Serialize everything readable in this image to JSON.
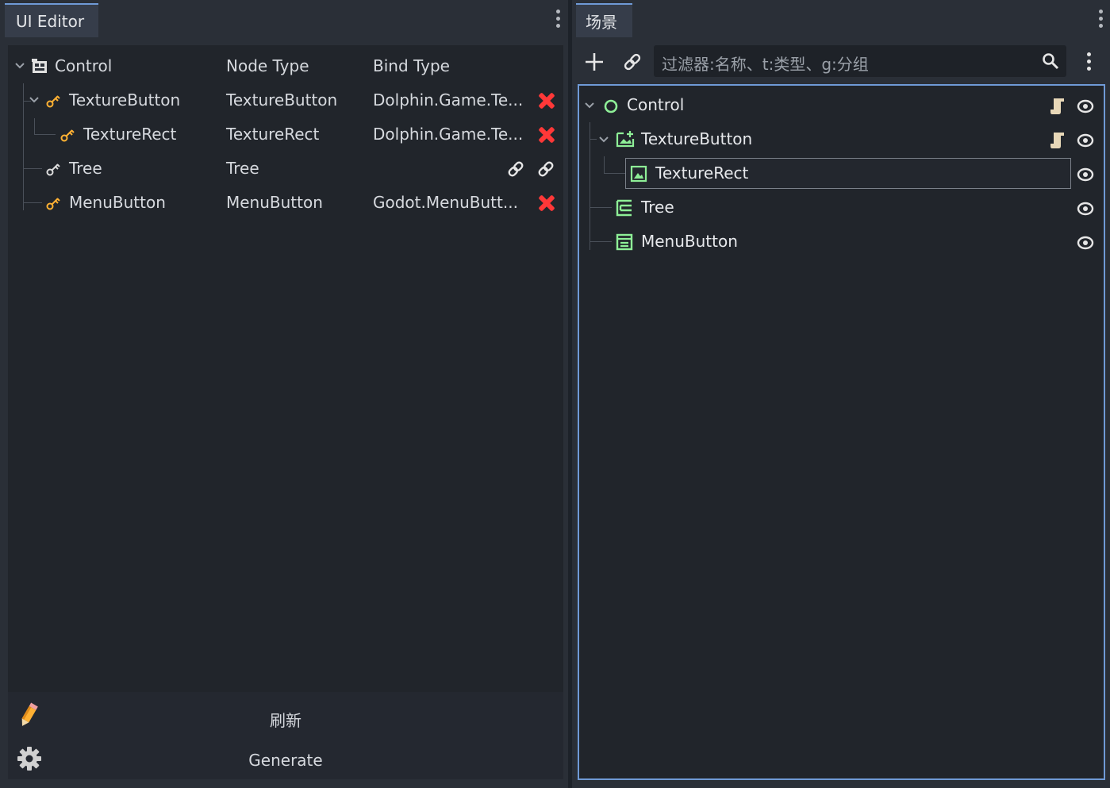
{
  "colors": {
    "accent": "#6f9ad6",
    "node_green": "#8eef97",
    "key_orange": "#ffb133",
    "delete_red": "#ff3838",
    "link_white": "#e6e6e6"
  },
  "left_panel": {
    "tab_title": "UI Editor",
    "headers": {
      "name": "Control",
      "node_type": "Node Type",
      "bind_type": "Bind Type"
    },
    "rows": [
      {
        "name": "TextureButton",
        "node_type": "TextureButton",
        "bind_type": "Dolphin.Game.Te...",
        "action": "delete-icon",
        "icon": "key-icon"
      },
      {
        "name": "TextureRect",
        "node_type": "TextureRect",
        "bind_type": "Dolphin.Game.Te...",
        "action": "delete-icon",
        "icon": "key-icon"
      },
      {
        "name": "Tree",
        "node_type": "Tree",
        "bind_type": "",
        "action": "link-icon",
        "icon": "key-icon"
      },
      {
        "name": "MenuButton",
        "node_type": "MenuButton",
        "bind_type": "Godot.MenuButt...",
        "action": "delete-icon",
        "icon": "key-icon"
      }
    ],
    "footer": {
      "refresh_label": "刷新",
      "generate_label": "Generate",
      "refresh_icon": "pencil-icon",
      "generate_icon": "gear-icon"
    }
  },
  "right_panel": {
    "tab_title": "场景",
    "filter_placeholder": "过滤器:名称、t:类型、g:分组",
    "nodes": [
      {
        "name": "Control",
        "icon": "control-circle-icon",
        "has_script": true,
        "visible": true
      },
      {
        "name": "TextureButton",
        "icon": "texture-button-icon",
        "has_script": true,
        "visible": true
      },
      {
        "name": "TextureRect",
        "icon": "texture-rect-icon",
        "has_script": false,
        "visible": true,
        "selected": true
      },
      {
        "name": "Tree",
        "icon": "tree-node-icon",
        "has_script": false,
        "visible": true
      },
      {
        "name": "MenuButton",
        "icon": "menu-button-icon",
        "has_script": false,
        "visible": true
      }
    ]
  }
}
